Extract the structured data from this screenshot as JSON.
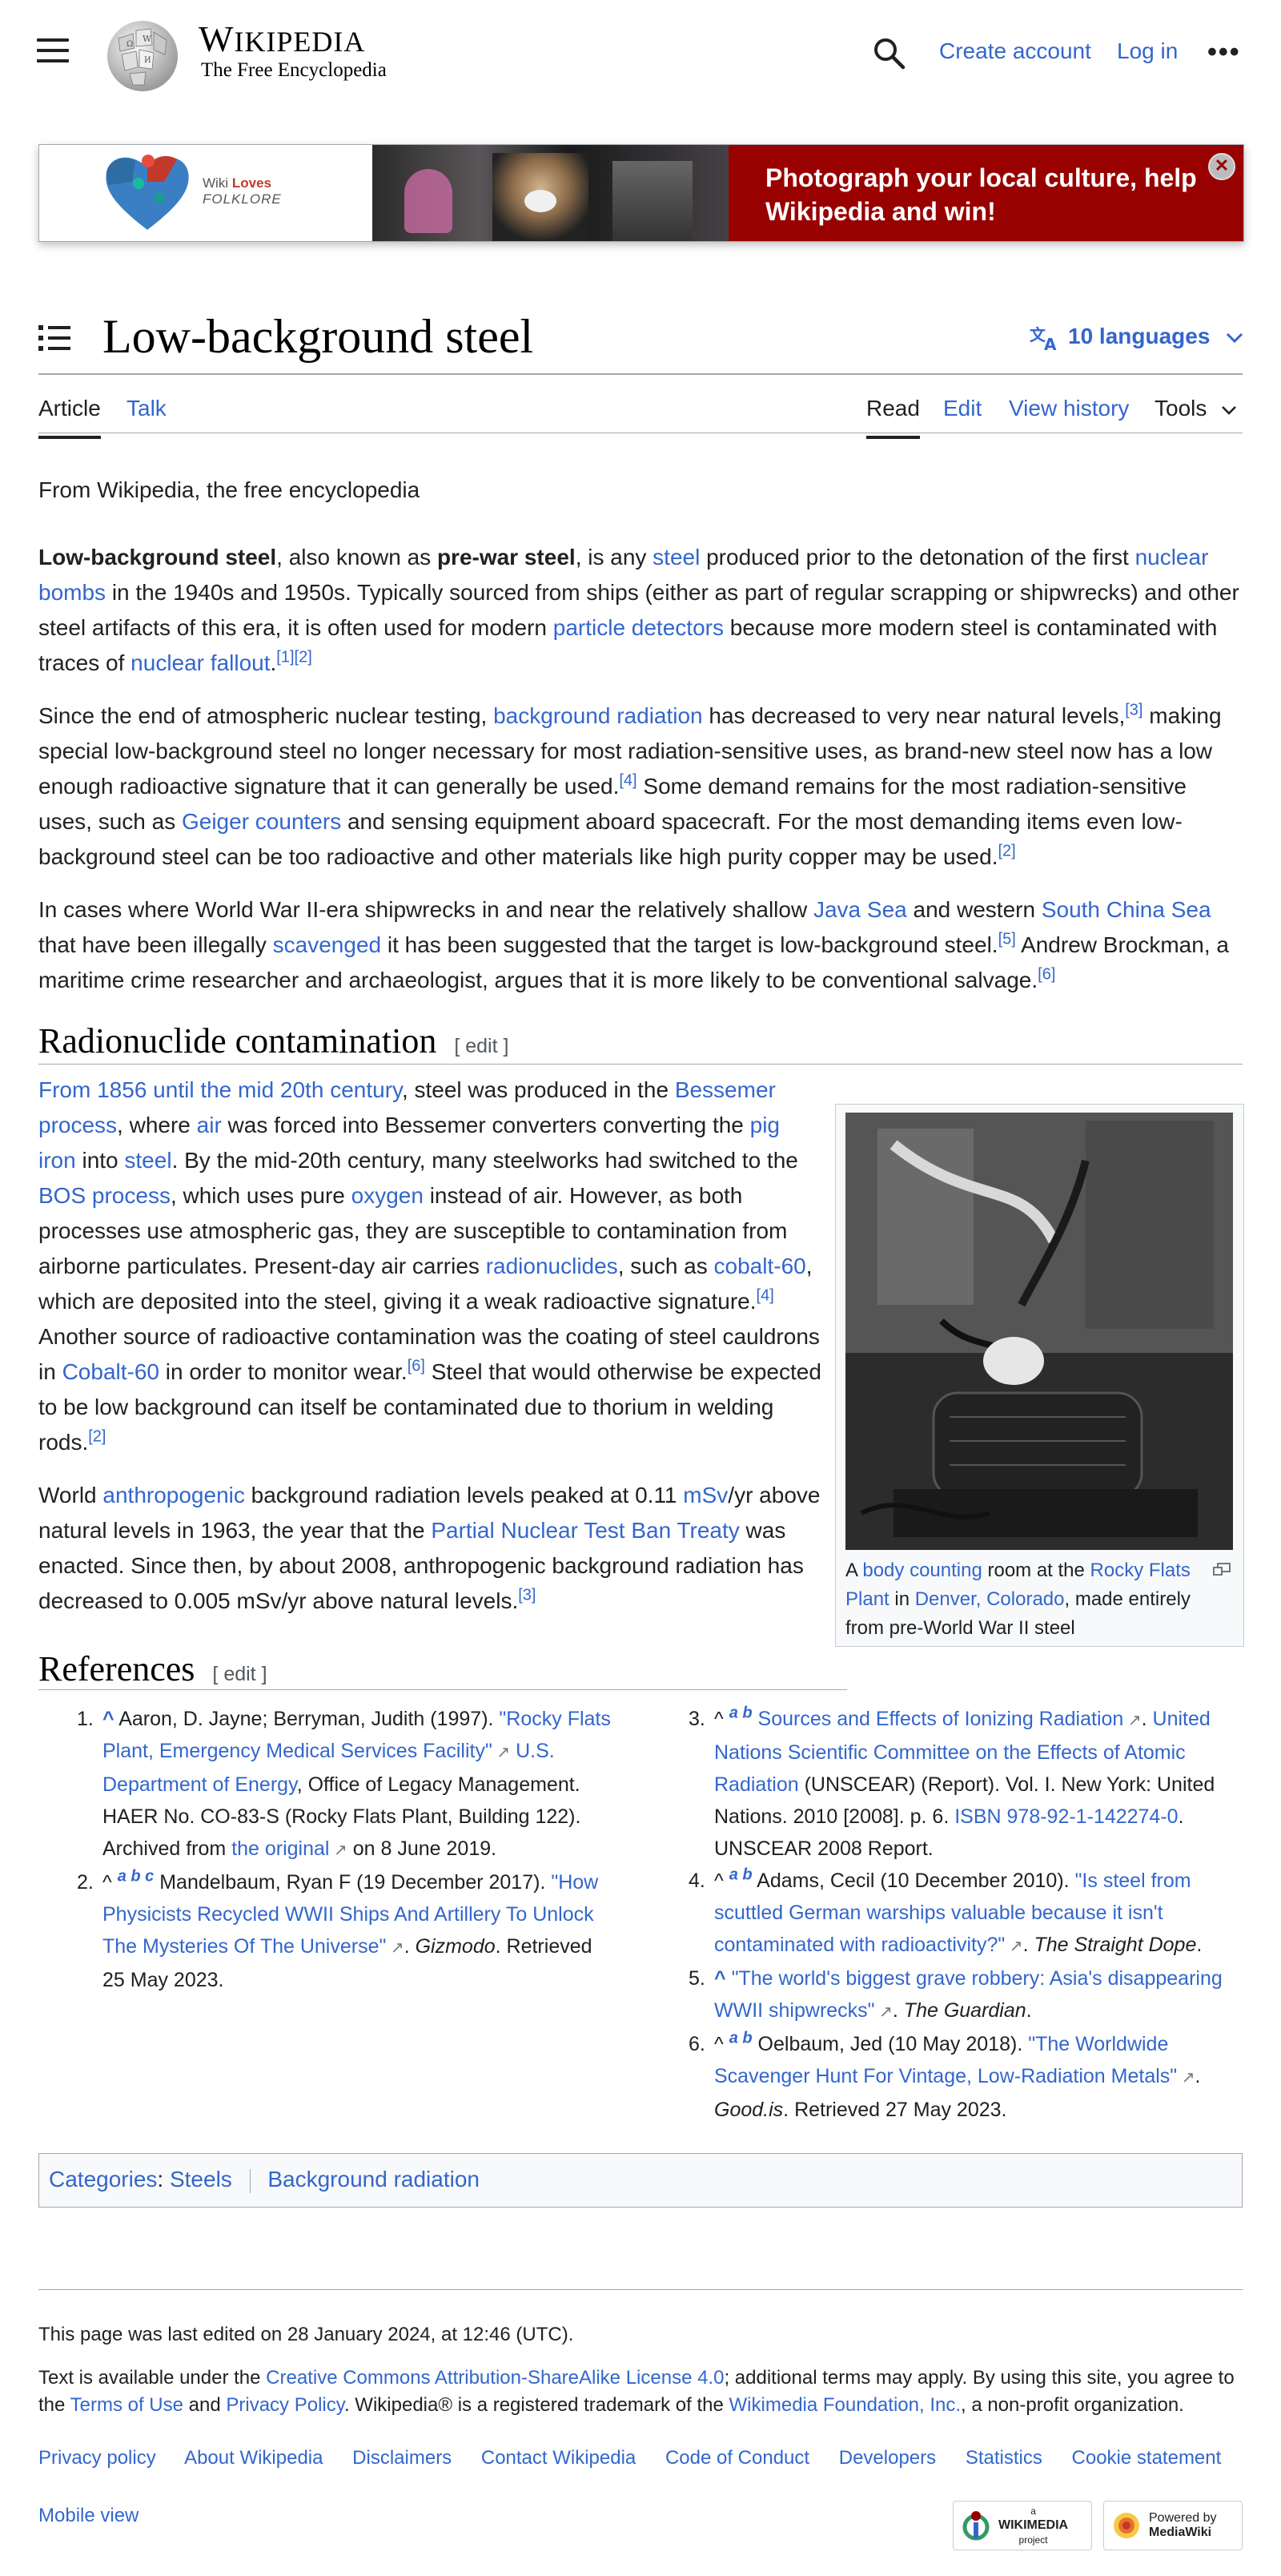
{
  "header": {
    "wordmark_big": "W",
    "wordmark_rest": "IKIPEDIA",
    "tagline": "The Free Encyclopedia",
    "create_account": "Create account",
    "log_in": "Log in",
    "more": "•••"
  },
  "banner": {
    "logo_wiki": "Wiki",
    "logo_loves": "Loves",
    "logo_folklore": "FOLKLORE",
    "cta_line1": "Photograph your local culture, help",
    "cta_line2": "Wikipedia and win!",
    "close": "✕"
  },
  "page": {
    "title": "Low-background steel",
    "languages": "10 languages"
  },
  "tabs": {
    "article": "Article",
    "talk": "Talk",
    "read": "Read",
    "edit": "Edit",
    "view_history": "View history",
    "tools": "Tools"
  },
  "article": {
    "from": "From Wikipedia, the free encyclopedia",
    "p1": {
      "b1": "Low-background steel",
      "t1": ", also known as ",
      "b2": "pre-war steel",
      "t2": ", is any ",
      "l1": "steel",
      "t3": " produced prior to the detonation of the first ",
      "l2": "nuclear bombs",
      "t4": " in the 1940s and 1950s. Typically sourced from ships (either as part of regular scrapping or shipwrecks) and other steel artifacts of this era, it is often used for modern ",
      "l3": "particle detectors",
      "t5": " because more modern steel is contaminated with traces of ",
      "l4": "nuclear fallout",
      "t6": ".",
      "s1": "[1]",
      "s2": "[2]"
    },
    "p2": {
      "t1": "Since the end of atmospheric nuclear testing, ",
      "l1": "background radiation",
      "t2": " has decreased to very near natural levels,",
      "s1": "[3]",
      "t3": " making special low-background steel no longer necessary for most radiation-sensitive uses, as brand-new steel now has a low enough radioactive signature that it can generally be used.",
      "s2": "[4]",
      "t4": " Some demand remains for the most radiation-sensitive uses, such as ",
      "l2": "Geiger counters",
      "t5": " and sensing equipment aboard spacecraft. For the most demanding items even low-background steel can be too radioactive and other materials like high purity copper may be used.",
      "s3": "[2]"
    },
    "p3": {
      "t1": "In cases where World War II-era shipwrecks in and near the relatively shallow ",
      "l1": "Java Sea",
      "t2": " and western ",
      "l2": "South China Sea",
      "t3": " that have been illegally ",
      "l3": "scavenged",
      "t4": " it has been suggested that the target is low-background steel.",
      "s1": "[5]",
      "t5": " Andrew Brockman, a maritime crime researcher and archaeologist, argues that it is more likely to be conventional salvage.",
      "s2": "[6]"
    },
    "section1": {
      "title": "Radionuclide contamination",
      "edit": "[ edit ]"
    },
    "p4": {
      "l1": "From 1856 until the mid 20th century",
      "t1": ", steel was produced in the ",
      "l2": "Bessemer process",
      "t2": ", where ",
      "l3": "air",
      "t3": " was forced into Bessemer converters converting the ",
      "l4": "pig iron",
      "t4": " into ",
      "l5": "steel",
      "t5": ". By the mid-20th century, many steelworks had switched to the ",
      "l6": "BOS process",
      "t6": ", which uses pure ",
      "l7": "oxygen",
      "t7": " instead of air. However, as both processes use atmospheric gas, they are susceptible to contamination from airborne particulates. Present-day air carries ",
      "l8": "radionuclides",
      "t8": ", such as ",
      "l9": "cobalt-60",
      "t9": ", which are deposited into the steel, giving it a weak radioactive signature.",
      "s1": "[4]",
      "t10": " Another source of radioactive contamination was the coating of steel cauldrons in ",
      "l10": "Cobalt-60",
      "t11": " in order to monitor wear.",
      "s2": "[6]",
      "t12": " Steel that would otherwise be expected to be low background can itself be contaminated due to thorium in welding rods.",
      "s3": "[2]"
    },
    "p5": {
      "t1": "World ",
      "l1": "anthropogenic",
      "t2": " background radiation levels peaked at 0.11 ",
      "l2": "mSv",
      "t3": "/yr above natural levels in 1963, the year that the ",
      "l3": "Partial Nuclear Test Ban Treaty",
      "t4": " was enacted. Since then, by about 2008, anthropogenic background radiation has decreased to 0.005 mSv/yr above natural levels.",
      "s1": "[3]"
    },
    "figure": {
      "c1": "A ",
      "l1": "body counting",
      "c2": " room at the ",
      "l2": "Rocky Flats Plant",
      "c3": " in ",
      "l3": "Denver, Colorado",
      "c4": ", made entirely from pre-World War II steel"
    },
    "section2": {
      "title": "References",
      "edit": "[ edit ]"
    }
  },
  "references_left": [
    {
      "n": "1.",
      "caret": "^",
      "t1": "Aaron, D. Jayne; Berryman, Judith (1997). ",
      "l1": "\"Rocky Flats Plant, Emergency Medical Services Facility\"",
      "t2": " ",
      "l2": "U.S. Department of Energy",
      "t3": ", Office of Legacy Management. HAER No. CO-83-S (Rocky Flats Plant, Building 122). Archived from ",
      "l3": "the original",
      "t4": " on 8 June 2019."
    },
    {
      "n": "2.",
      "caret": "^",
      "backs": "a b c",
      "t1": " Mandelbaum, Ryan F (19 December 2017). ",
      "l1": "\"How Physicists Recycled WWII Ships And Artillery To Unlock The Mysteries Of The Universe\"",
      "t2": ". ",
      "i1": "Gizmodo",
      "t3": ". Retrieved 25 May 2023."
    }
  ],
  "references_right": [
    {
      "n": "3.",
      "caret": "^",
      "backs": "a b",
      "l1": "Sources and Effects of Ionizing Radiation",
      "t1": ". ",
      "l2": "United Nations Scientific Committee on the Effects of Atomic Radiation",
      "t2": " (UNSCEAR) (Report). Vol. I. New York: United Nations. 2010 [2008]. p. 6. ",
      "l3": "ISBN 978-92-1-142274-0",
      "t3": ". UNSCEAR 2008 Report."
    },
    {
      "n": "4.",
      "caret": "^",
      "backs": "a b",
      "t1": " Adams, Cecil (10 December 2010). ",
      "l1": "\"Is steel from scuttled German warships valuable because it isn't contaminated with radioactivity?\"",
      "t2": ". ",
      "i1": "The Straight Dope",
      "t3": "."
    },
    {
      "n": "5.",
      "caret": "^",
      "l1": "\"The world's biggest grave robbery: Asia's disappearing WWII shipwrecks\"",
      "t1": ". ",
      "i1": "The Guardian",
      "t2": "."
    },
    {
      "n": "6.",
      "caret": "^",
      "backs": "a b",
      "t1": " Oelbaum, Jed (10 May 2018). ",
      "l1": "\"The Worldwide Scavenger Hunt For Vintage, Low-Radiation Metals\"",
      "t2": ". ",
      "i1": "Good.is",
      "t3": ". Retrieved 27 May 2023."
    }
  ],
  "categories": {
    "label": "Categories",
    "items": [
      "Steels",
      "Background radiation"
    ]
  },
  "footer": {
    "last_edited": "This page was last edited on 28 January 2024, at 12:46 (UTC).",
    "license_t1": "Text is available under the ",
    "license_l1": "Creative Commons Attribution-ShareAlike License 4.0",
    "license_t2": "; additional terms may apply. By using this site, you agree to the ",
    "license_l2": "Terms of Use",
    "license_t3": " and ",
    "license_l3": "Privacy Policy",
    "license_t4": ". Wikipedia® is a registered trademark of the ",
    "license_l4": "Wikimedia Foundation, Inc.",
    "license_t5": ", a non-profit organization.",
    "links": [
      "Privacy policy",
      "About Wikipedia",
      "Disclaimers",
      "Contact Wikipedia",
      "Code of Conduct",
      "Developers",
      "Statistics",
      "Cookie statement"
    ],
    "mobile_view": "Mobile view",
    "wm_badge_small": "a",
    "wm_badge_big": "WIKIMEDIA",
    "wm_badge_sub": "project",
    "mw_badge_small": "Powered by",
    "mw_badge_big": "MediaWiki"
  },
  "colors": {
    "link": "#3366cc",
    "banner_red": "#990000",
    "text": "#202122",
    "border": "#a2a9b1"
  }
}
